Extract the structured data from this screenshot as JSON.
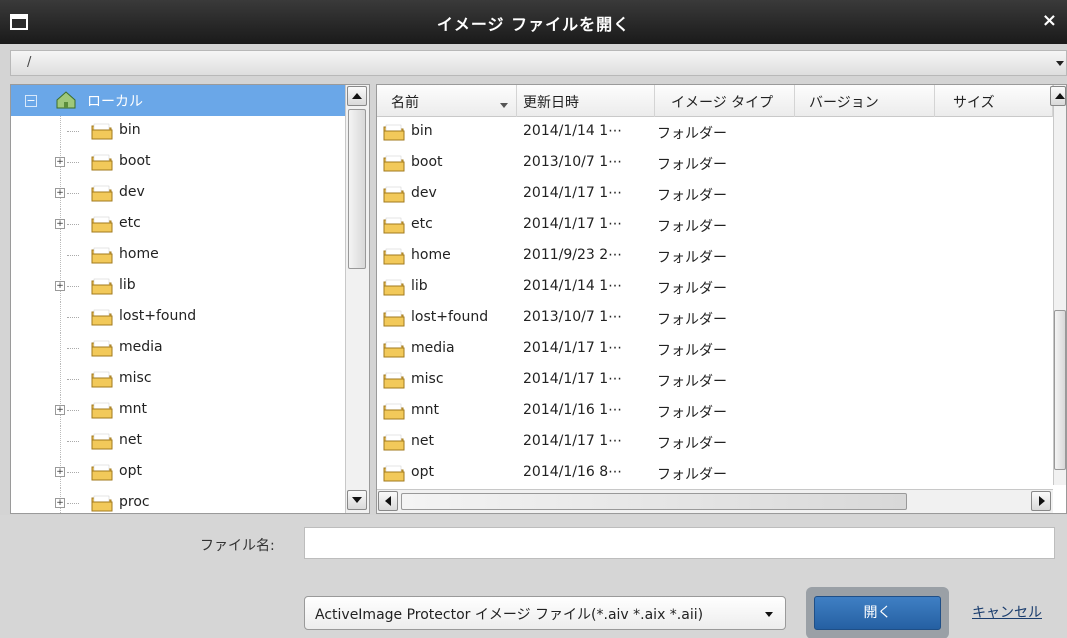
{
  "window": {
    "title": "イメージ ファイルを開く",
    "close_glyph": "×"
  },
  "path_bar": {
    "path": "/"
  },
  "tree": {
    "root_label": "ローカル",
    "items": [
      {
        "label": "bin",
        "expandable": false
      },
      {
        "label": "boot",
        "expandable": true
      },
      {
        "label": "dev",
        "expandable": true
      },
      {
        "label": "etc",
        "expandable": true
      },
      {
        "label": "home",
        "expandable": false
      },
      {
        "label": "lib",
        "expandable": true
      },
      {
        "label": "lost+found",
        "expandable": false
      },
      {
        "label": "media",
        "expandable": false
      },
      {
        "label": "misc",
        "expandable": false
      },
      {
        "label": "mnt",
        "expandable": true
      },
      {
        "label": "net",
        "expandable": false
      },
      {
        "label": "opt",
        "expandable": true
      },
      {
        "label": "proc",
        "expandable": true
      }
    ]
  },
  "list": {
    "columns": [
      "名前",
      "更新日時",
      "イメージ タイプ",
      "バージョン",
      "サイズ"
    ],
    "rows": [
      {
        "name": "bin",
        "date": "2014/1/14 1⋯",
        "type": "フォルダー"
      },
      {
        "name": "boot",
        "date": "2013/10/7 1⋯",
        "type": "フォルダー"
      },
      {
        "name": "dev",
        "date": "2014/1/17 1⋯",
        "type": "フォルダー"
      },
      {
        "name": "etc",
        "date": "2014/1/17 1⋯",
        "type": "フォルダー"
      },
      {
        "name": "home",
        "date": "2011/9/23 2⋯",
        "type": "フォルダー"
      },
      {
        "name": "lib",
        "date": "2014/1/14 1⋯",
        "type": "フォルダー"
      },
      {
        "name": "lost+found",
        "date": "2013/10/7 1⋯",
        "type": "フォルダー"
      },
      {
        "name": "media",
        "date": "2014/1/17 1⋯",
        "type": "フォルダー"
      },
      {
        "name": "misc",
        "date": "2014/1/17 1⋯",
        "type": "フォルダー"
      },
      {
        "name": "mnt",
        "date": "2014/1/16 1⋯",
        "type": "フォルダー"
      },
      {
        "name": "net",
        "date": "2014/1/17 1⋯",
        "type": "フォルダー"
      },
      {
        "name": "opt",
        "date": "2014/1/16 8⋯",
        "type": "フォルダー"
      }
    ]
  },
  "footer": {
    "filename_label": "ファイル名:",
    "filename_value": "",
    "filter_value": "ActiveImage Protector イメージ ファイル(*.aiv *.aix *.aii)",
    "open_label": "開く",
    "cancel_label": "キャンセル"
  },
  "colors": {
    "selection": "#6aa7e8",
    "primary_button": "#2f6db5",
    "titlebar": "#2a2a2a"
  }
}
